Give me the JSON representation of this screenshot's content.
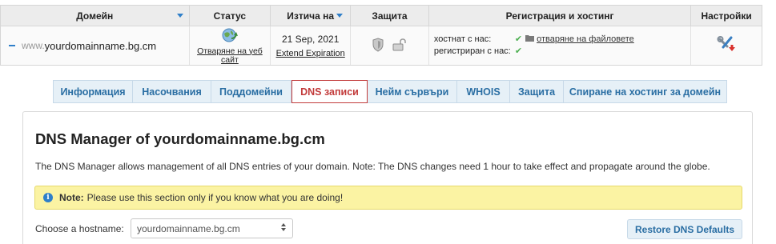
{
  "table": {
    "headers": {
      "domain": "Домейн",
      "status": "Статус",
      "expires": "Изтича на",
      "protection": "Защита",
      "registration": "Регистрация и хостинг",
      "settings": "Настройки"
    },
    "row": {
      "www_prefix": "www.",
      "domain_name": "yourdomainname.bg.cm",
      "status_link": "Отваряне на уеб сайт",
      "expiry_date": "21 Sep, 2021",
      "extend_link": "Extend Expiration",
      "hosted_label": "хостнат с нас:",
      "registered_label": "регистриран с нас:",
      "file_manager_link": "отваряне на файловете"
    },
    "icons": {
      "status": "globe-refresh-icon",
      "protection_shield": "shield-icon",
      "protection_lock": "padlock-icon",
      "settings": "tools-icon"
    }
  },
  "tabs": [
    {
      "label": "Информация",
      "active": false
    },
    {
      "label": "Насочвания",
      "active": false
    },
    {
      "label": "Поддомейни",
      "active": false
    },
    {
      "label": "DNS записи",
      "active": true
    },
    {
      "label": "Нейм сървъри",
      "active": false
    },
    {
      "label": "WHOIS",
      "active": false
    },
    {
      "label": "Защита",
      "active": false
    },
    {
      "label": "Спиране на хостинг за домейн",
      "active": false
    }
  ],
  "dns": {
    "title": "DNS Manager of yourdomainname.bg.cm",
    "description": "The DNS Manager allows management of all DNS entries of your domain. Note: The DNS changes need 1 hour to take effect and propagate around the globe.",
    "note_label": "Note:",
    "note_text": "Please use this section only if you know what you are doing!",
    "hostname_label": "Choose a hostname:",
    "hostname_value": "yourdomainname.bg.cm",
    "restore_button": "Restore DNS Defaults"
  },
  "colors": {
    "accent": "#2f7fc9",
    "active_tab": "#c23b3b",
    "tab_bg": "#e6f0f7",
    "note_bg": "#fbf3a3",
    "check": "#4caf50"
  }
}
